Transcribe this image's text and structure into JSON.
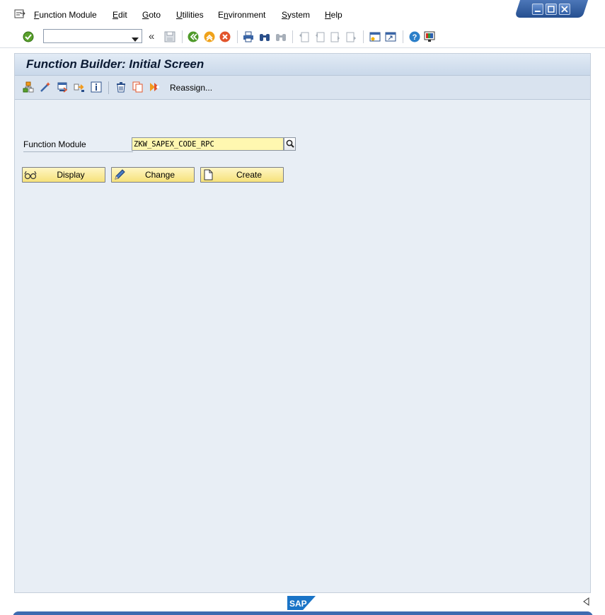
{
  "menu": {
    "items": [
      {
        "label": "Function Module",
        "mnemonic_index": 0
      },
      {
        "label": "Edit",
        "mnemonic_index": 0
      },
      {
        "label": "Goto",
        "mnemonic_index": 0
      },
      {
        "label": "Utilities",
        "mnemonic_index": 0
      },
      {
        "label": "Environment",
        "mnemonic_index": 1
      },
      {
        "label": "System",
        "mnemonic_index": 0
      },
      {
        "label": "Help",
        "mnemonic_index": 0
      }
    ]
  },
  "toolbar": {
    "command_value": "",
    "icons": [
      "enter-icon",
      "save-icon",
      "back-icon",
      "exit-icon",
      "cancel-icon",
      "print-icon",
      "find-icon",
      "find-next-icon",
      "first-page-icon",
      "previous-page-icon",
      "next-page-icon",
      "last-page-icon",
      "create-session-icon",
      "shortcut-icon",
      "help-icon",
      "customize-layout-icon"
    ]
  },
  "screen": {
    "title": "Function Builder: Initial Screen",
    "app_toolbar": {
      "icons": [
        "hierarchy-icon",
        "magic-wand-icon",
        "test-icon",
        "where-used-icon",
        "info-icon",
        "delete-icon",
        "copy-icon",
        "rename-icon"
      ],
      "reassign_label": "Reassign..."
    },
    "field": {
      "label": "Function Module",
      "value": "ZKW_SAPEX_CODE_RPC"
    },
    "buttons": {
      "display": "Display",
      "change": "Change",
      "create": "Create"
    }
  },
  "footer": {
    "logo": "SAP"
  },
  "colors": {
    "screen_bg": "#e8eef5",
    "input_bg": "#fff7b0",
    "button_bg": "#f6e27a",
    "window_controls": "#254f90"
  }
}
